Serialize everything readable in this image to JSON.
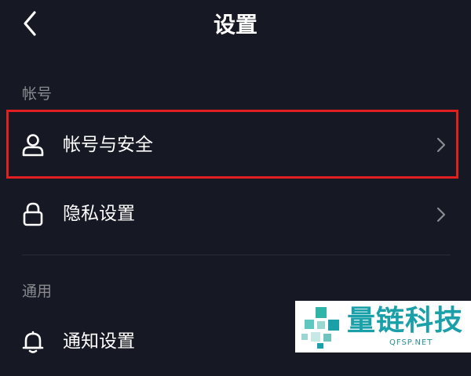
{
  "header": {
    "title": "设置"
  },
  "sections": [
    {
      "label": "帐号",
      "items": [
        {
          "label": "帐号与安全",
          "icon": "user-icon"
        },
        {
          "label": "隐私设置",
          "icon": "lock-icon"
        }
      ]
    },
    {
      "label": "通用",
      "items": [
        {
          "label": "通知设置",
          "icon": "bell-icon"
        }
      ]
    }
  ],
  "watermark": {
    "brand": "量链科技",
    "url": "QFSP.NET"
  },
  "colors": {
    "background": "#161823",
    "highlight": "#e02020",
    "secondary_text": "#8a8b91",
    "watermark_accent": "#1aa0a8"
  }
}
